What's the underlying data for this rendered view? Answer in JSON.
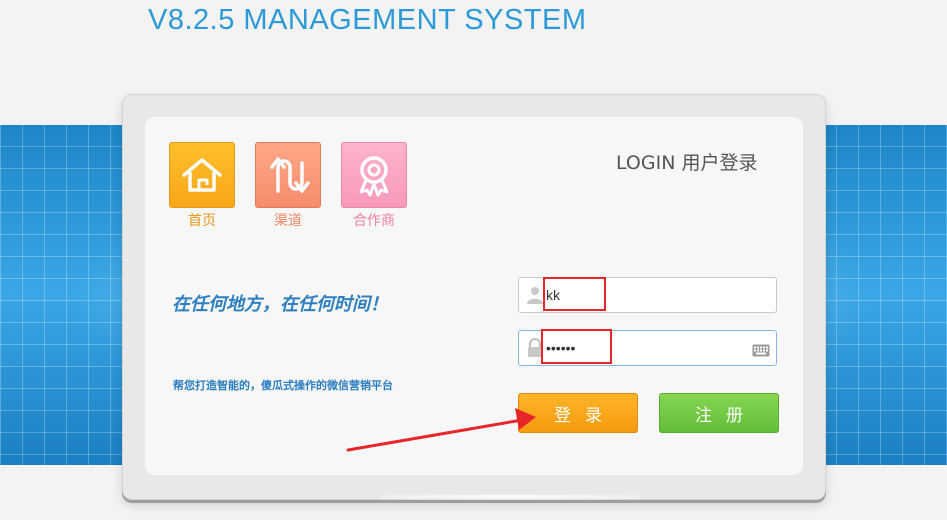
{
  "header": {
    "title": "V8.2.5 MANAGEMENT SYSTEM"
  },
  "nav": {
    "tiles": [
      {
        "label": "首页",
        "icon": "home-icon",
        "color": "#f9a61b"
      },
      {
        "label": "渠道",
        "icon": "transfer-arrows-icon",
        "color": "#f58c6c"
      },
      {
        "label": "合作商",
        "icon": "award-ribbon-icon",
        "color": "#f799ba"
      }
    ]
  },
  "login": {
    "title": "LOGIN 用户登录",
    "slogan": "在任何地方，在任何时间！",
    "subslogan": "帮您打造智能的，傻瓜式操作的微信营销平台",
    "username": {
      "value": "kk",
      "icon": "user-icon"
    },
    "password": {
      "value": "••••••",
      "icon": "lock-icon",
      "keyboard_icon": "keyboard-icon"
    },
    "login_label": "登录",
    "register_label": "注册"
  },
  "colors": {
    "accent": "#2c9ad8",
    "login_button": "#f59a0f",
    "register_button": "#62bd38",
    "annotation": "#e8262a"
  }
}
